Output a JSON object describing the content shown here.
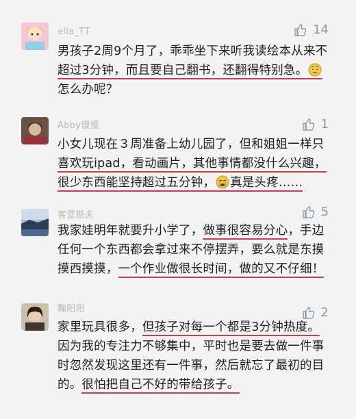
{
  "comments": [
    {
      "username": "ella_TT",
      "likes": "14",
      "lines": [
        "男孩子2周9个月了，乖乖坐下来听我读绘本从来不",
        "超过3分钟，而且要自己翻书，还翻得特别急。",
        "怎么办呢？"
      ],
      "emoji": "worried-face-emoji"
    },
    {
      "username": "Abby慢慢",
      "likes": "1",
      "lines": [
        "小女儿现在３周准备上幼儿园了，但和姐姐一样只",
        "喜欢玩ipad，看动画片，其他事情都没什么兴趣，",
        "很少东西能坚持超过五分钟，",
        "真是头疼……"
      ],
      "emoji": "crying-face-emoji"
    },
    {
      "username": "客蓝斯夫",
      "likes": "5",
      "lines": [
        "我家娃明年就要升小学了，",
        "做事很容易分心",
        "，手边",
        "任何一个东西都会拿过来不停摆弄，要么就是东摸",
        "摸西摸摸，",
        "一个作业做很长时间，做的又不仔细！"
      ]
    },
    {
      "username": "鞠阳阳",
      "likes": "2",
      "lines": [
        "家里玩具很多，",
        "但孩子对每一个都是3分钟热度。",
        "因为我的专注力不够集中，平时也是要去做一件事",
        "时忽然发现这里还有一件事，然后就忘了最初的目",
        "的。",
        "很怕把自己不好的带给孩子。"
      ]
    }
  ],
  "colors": {
    "background": "#f3f3f3",
    "underline": "#c8414a",
    "like_icon": "#8b9bb0",
    "username": "#b7b7b7"
  }
}
